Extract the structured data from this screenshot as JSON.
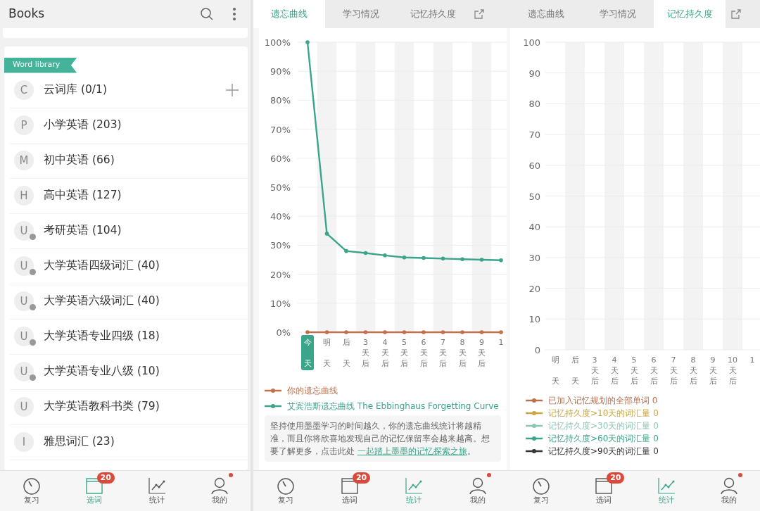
{
  "library_screen": {
    "title": "Books",
    "section_label": "Word library",
    "books": [
      {
        "letter": "C",
        "name": "云词库 (0/1)",
        "badge": false,
        "addable": true
      },
      {
        "letter": "P",
        "name": "小学英语 (203)",
        "badge": false,
        "addable": false
      },
      {
        "letter": "M",
        "name": "初中英语 (66)",
        "badge": false,
        "addable": false
      },
      {
        "letter": "H",
        "name": "高中英语 (127)",
        "badge": false,
        "addable": false
      },
      {
        "letter": "U",
        "name": "考研英语 (104)",
        "badge": true,
        "addable": false
      },
      {
        "letter": "U",
        "name": "大学英语四级词汇 (40)",
        "badge": true,
        "addable": false
      },
      {
        "letter": "U",
        "name": "大学英语六级词汇 (40)",
        "badge": true,
        "addable": false
      },
      {
        "letter": "U",
        "name": "大学英语专业四级 (18)",
        "badge": true,
        "addable": false
      },
      {
        "letter": "U",
        "name": "大学英语专业八级 (10)",
        "badge": true,
        "addable": false
      },
      {
        "letter": "U",
        "name": "大学英语教科书类 (79)",
        "badge": false,
        "addable": false
      },
      {
        "letter": "I",
        "name": "雅思词汇 (23)",
        "badge": false,
        "addable": false
      }
    ],
    "nav": [
      {
        "kind": "review",
        "label": "复习",
        "selected": false,
        "notification": false
      },
      {
        "kind": "words",
        "label": "选词",
        "selected": true,
        "badge": "20",
        "notification": false
      },
      {
        "kind": "stats",
        "label": "统计",
        "selected": false,
        "notification": false
      },
      {
        "kind": "profile",
        "label": "我的",
        "selected": false,
        "notification": true
      }
    ]
  },
  "forgetting_screen": {
    "tabs": [
      {
        "label": "遗忘曲线",
        "selected": true
      },
      {
        "label": "学习情况",
        "selected": false
      },
      {
        "label": "记忆持久度",
        "selected": false
      }
    ],
    "today_highlighted": true,
    "chart_data": {
      "type": "line",
      "grid": true,
      "categories": [
        "今天",
        "明天",
        "后天",
        "3天后",
        "4天后",
        "5天后",
        "6天后",
        "7天后",
        "8天后",
        "9天后",
        "1"
      ],
      "ylim": [
        0,
        100
      ],
      "yticks": [
        {
          "value": 0,
          "label": "0%"
        },
        {
          "value": 10,
          "label": "10%"
        },
        {
          "value": 20,
          "label": "20%"
        },
        {
          "value": 30,
          "label": "30%"
        },
        {
          "value": 40,
          "label": "40%"
        },
        {
          "value": 50,
          "label": "50%"
        },
        {
          "value": 60,
          "label": "60%"
        },
        {
          "value": 70,
          "label": "70%"
        },
        {
          "value": 80,
          "label": "80%"
        },
        {
          "value": 90,
          "label": "90%"
        },
        {
          "value": 100,
          "label": "100%"
        }
      ],
      "series": [
        {
          "name": "你的遗忘曲线",
          "color": "#c0704a",
          "values": [
            0,
            0,
            0,
            0,
            0,
            0,
            0,
            0,
            0,
            0,
            0
          ]
        },
        {
          "name": "艾宾浩斯遗忘曲线 The Ebbinghaus Forgetting Curve",
          "color": "#3aa58a",
          "values": [
            100,
            34,
            28,
            27.3,
            26.5,
            25.8,
            25.6,
            25.4,
            25.2,
            25,
            24.8
          ]
        }
      ]
    },
    "note": "坚持使用墨墨学习的时间越久，你的遗忘曲线统计将越精准，而且你将欣喜地发现自己的记忆保留率会越来越高。想要了解更多，点击此处 ",
    "note_link": "一起踏上墨墨的记忆探索之旅",
    "note_end": "。",
    "nav": [
      {
        "kind": "review",
        "label": "复习",
        "selected": false,
        "notification": false
      },
      {
        "kind": "words",
        "label": "选词",
        "selected": false,
        "badge": "20",
        "notification": false
      },
      {
        "kind": "stats",
        "label": "统计",
        "selected": true,
        "notification": false
      },
      {
        "kind": "profile",
        "label": "我的",
        "selected": false,
        "notification": true
      }
    ]
  },
  "durability_screen": {
    "tabs": [
      {
        "label": "遗忘曲线",
        "selected": false
      },
      {
        "label": "学习情况",
        "selected": false
      },
      {
        "label": "记忆持久度",
        "selected": true
      }
    ],
    "chart_data": {
      "type": "line",
      "grid": true,
      "categories": [
        "明天",
        "后天",
        "3天后",
        "4天后",
        "5天后",
        "6天后",
        "7天后",
        "8天后",
        "9天后",
        "10天后",
        "1"
      ],
      "ylim": [
        0,
        100
      ],
      "yticks": [
        0,
        10,
        20,
        30,
        40,
        50,
        60,
        70,
        80,
        90,
        100
      ]
    },
    "legend": [
      {
        "label": "已加入记忆规划的全部单词 0",
        "color": "#b5704e"
      },
      {
        "label": "记忆持久度>10天的词汇量 0",
        "color": "#c9a53c"
      },
      {
        "label": "记忆持久度>30天的词汇量 0",
        "color": "#8cc4b6"
      },
      {
        "label": "记忆持久度>60天的词汇量 0",
        "color": "#3aa58a"
      },
      {
        "label": "记忆持久度>90天的词汇量 0",
        "color": "#333333"
      }
    ],
    "nav": [
      {
        "kind": "review",
        "label": "复习",
        "selected": false,
        "notification": false
      },
      {
        "kind": "words",
        "label": "选词",
        "selected": false,
        "badge": "20",
        "notification": false
      },
      {
        "kind": "stats",
        "label": "统计",
        "selected": true,
        "notification": false
      },
      {
        "kind": "profile",
        "label": "我的",
        "selected": false,
        "notification": true
      }
    ]
  }
}
